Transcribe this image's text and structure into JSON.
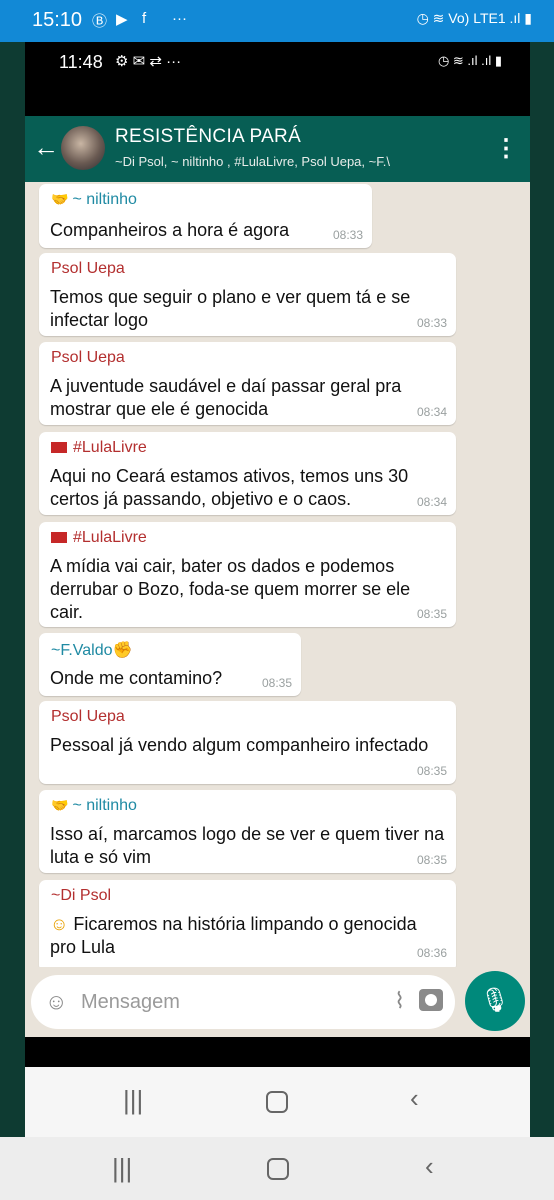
{
  "outer_status": {
    "time": "15:10",
    "right": "◷ ≋ Vo) LTE1 .ıl ▮"
  },
  "inner_status": {
    "time": "11:48",
    "right": "◷ ≋ .ıl .ıl ▮"
  },
  "chat_header": {
    "title": "RESISTÊNCIA PARÁ",
    "subtitle": "~Di Psol, ~ niltinho , #LulaLivre, Psol Uepa, ~F.\\"
  },
  "messages": [
    {
      "sender": "~ niltinho",
      "text": "Companheiros a hora é agora",
      "time": "08:33"
    },
    {
      "sender": "Psol Uepa",
      "text": "Temos que seguir o plano e ver quem tá e se infectar logo",
      "time": "08:33"
    },
    {
      "sender": "Psol Uepa",
      "text": "A juventude saudável e daí passar geral pra mostrar que ele é genocida",
      "time": "08:34"
    },
    {
      "sender": "#LulaLivre",
      "text": "Aqui no Ceará estamos ativos, temos uns 30 certos já passando, objetivo e o caos.",
      "time": "08:34"
    },
    {
      "sender": "#LulaLivre",
      "text": "A mídia vai cair, bater os dados e podemos derrubar o Bozo, foda-se quem morrer se ele cair.",
      "time": "08:35"
    },
    {
      "sender": "~F.Valdo",
      "text": "Onde me contamino?",
      "time": "08:35"
    },
    {
      "sender": "Psol Uepa",
      "text": "Pessoal já vendo algum companheiro infectado",
      "time": "08:35"
    },
    {
      "sender": "~ niltinho",
      "text": "Isso aí, marcamos logo de se ver e quem tiver na luta e só vim",
      "time": "08:35"
    },
    {
      "sender": "~Di Psol",
      "text": "Ficaremos na história limpando o genocida pro Lula",
      "time": "08:36"
    }
  ],
  "input": {
    "placeholder": "Mensagem"
  },
  "colors": {
    "header": "#075e54",
    "accent": "#00897b",
    "status_bar": "#1289d6",
    "chat_bg": "#e9e3da"
  }
}
